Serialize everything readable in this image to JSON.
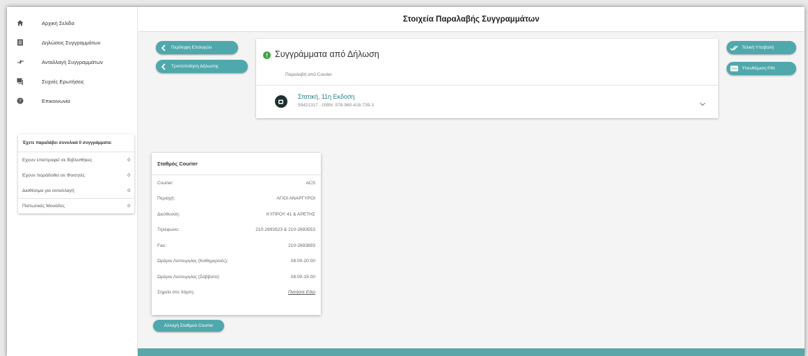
{
  "sidebar": {
    "items": [
      {
        "label": "Αρχική Σελίδα",
        "icon": "home-icon"
      },
      {
        "label": "Δηλώσεις Συγγραμμάτων",
        "icon": "list-icon"
      },
      {
        "label": "Ανταλλαγή Συγγραμμάτων",
        "icon": "swap-icon"
      },
      {
        "label": "Συχνές Ερωτήσεις",
        "icon": "forum-icon"
      },
      {
        "label": "Επικοινωνία",
        "icon": "help-icon"
      }
    ],
    "stats": {
      "heading": "Έχετε παραλάβει συνολικά 0 συγγράμματα:",
      "rows": [
        {
          "label": "Εχουν επιστραφεί σε Βιβλιοθήκες",
          "value": "0"
        },
        {
          "label": "Εχουν παράδοθεί σε Φοιτητές",
          "value": "0"
        },
        {
          "label": "Διαθέσιμα για ανταλλαγή",
          "value": "0"
        },
        {
          "label": "Πιστωτικές Μονάδες",
          "value": "0"
        }
      ]
    }
  },
  "header": {
    "title": "Στοιχεία Παραλαβής Συγγραμμάτων"
  },
  "actions": {
    "summary_label": "Περίληψη Επιλογών",
    "modify_label": "Τροποποίηση Δήλωσης",
    "submit_label": "Τελική Υποβολή",
    "pin_label": "Υπενθύμιση PIN",
    "change_courier_label": "Αλλαγή Σταθμού Courier"
  },
  "panel": {
    "title": "Συγγράμματα από Δήλωση",
    "subtitle": "Παραλαβή από Courier",
    "book": {
      "title": "Στατική, 11η Εκδοση",
      "meta": "59421317 - ISBN: 978-960-418-739-3"
    }
  },
  "courier": {
    "heading": "Σταθμός Courier",
    "rows": [
      {
        "label": "Courier:",
        "value": "ACS"
      },
      {
        "label": "Περιοχή:",
        "value": "ΑΓΙΟΙ ΑΝΑΡΓΥΡΟΙ"
      },
      {
        "label": "Διεύθυνση:",
        "value": "ΚΥΠΡΟΥ 41 & ΑΡΕΤΗΣ"
      },
      {
        "label": "Τηλέφωνο:",
        "value": "210-2693523 & 210-2693553"
      },
      {
        "label": "Fax:",
        "value": "210-2693893"
      },
      {
        "label": "Ωράριο Λειτουργίας (Καθημερινές):",
        "value": "08:00-20:00"
      },
      {
        "label": "Ωράριο Λειτουργίας (Σάββατο):",
        "value": "08:00-15:00"
      }
    ],
    "map_label": "Σημείο στο Χάρτη:",
    "map_link": "Πατήστε Εδώ"
  },
  "colors": {
    "accent": "#4fa8ab",
    "success": "#43a047",
    "link": "#2a7f86",
    "footer": "#5aa6a8"
  }
}
